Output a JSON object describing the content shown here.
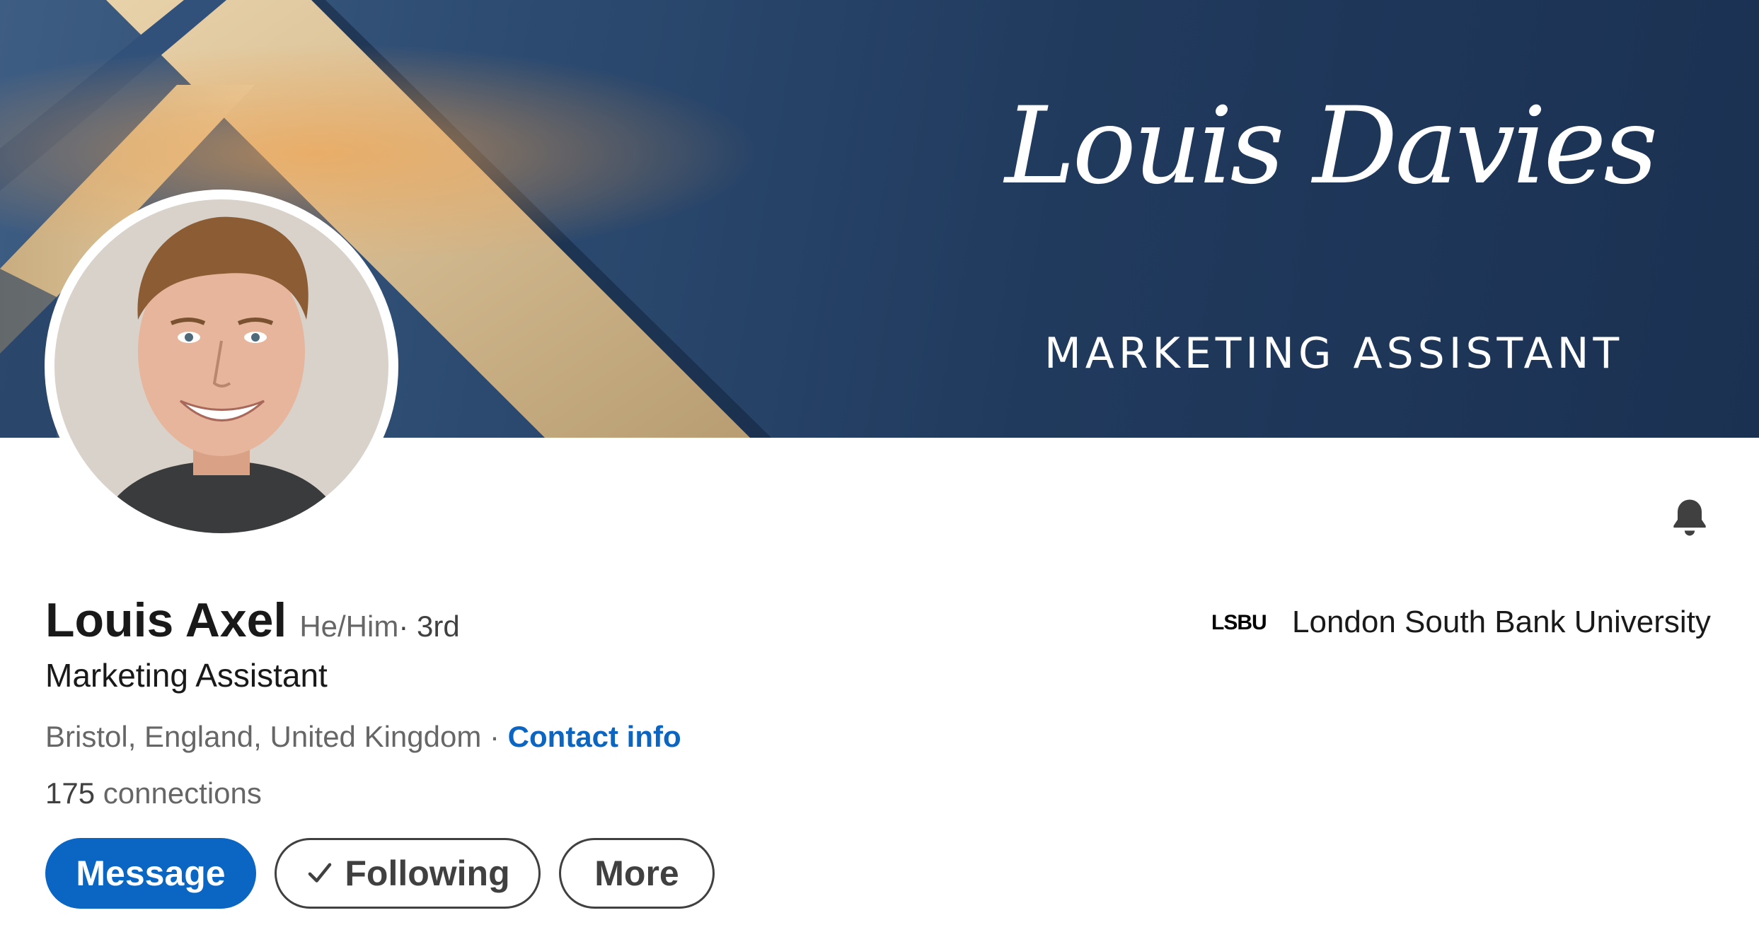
{
  "banner": {
    "signature_text": "Louis Davies",
    "subtitle": "MARKETING ASSISTANT"
  },
  "profile": {
    "name": "Louis Axel",
    "pronouns": "He/Him",
    "degree": " · 3rd",
    "headline": "Marketing Assistant",
    "location": "Bristol, England, United Kingdom",
    "location_separator": " · ",
    "contact_info": "Contact info",
    "connections_count": "175",
    "connections_label": " connections"
  },
  "actions": {
    "message": "Message",
    "following": "Following",
    "more": "More"
  },
  "education": {
    "logo_text": "LSBU",
    "name": "London South Bank University"
  },
  "icons": {
    "notification": "bell-icon",
    "following_check": "checkmark-icon"
  },
  "colors": {
    "primary": "#0a66c2",
    "banner_navy": "#203a5d",
    "banner_gold": "#d4bb92"
  }
}
